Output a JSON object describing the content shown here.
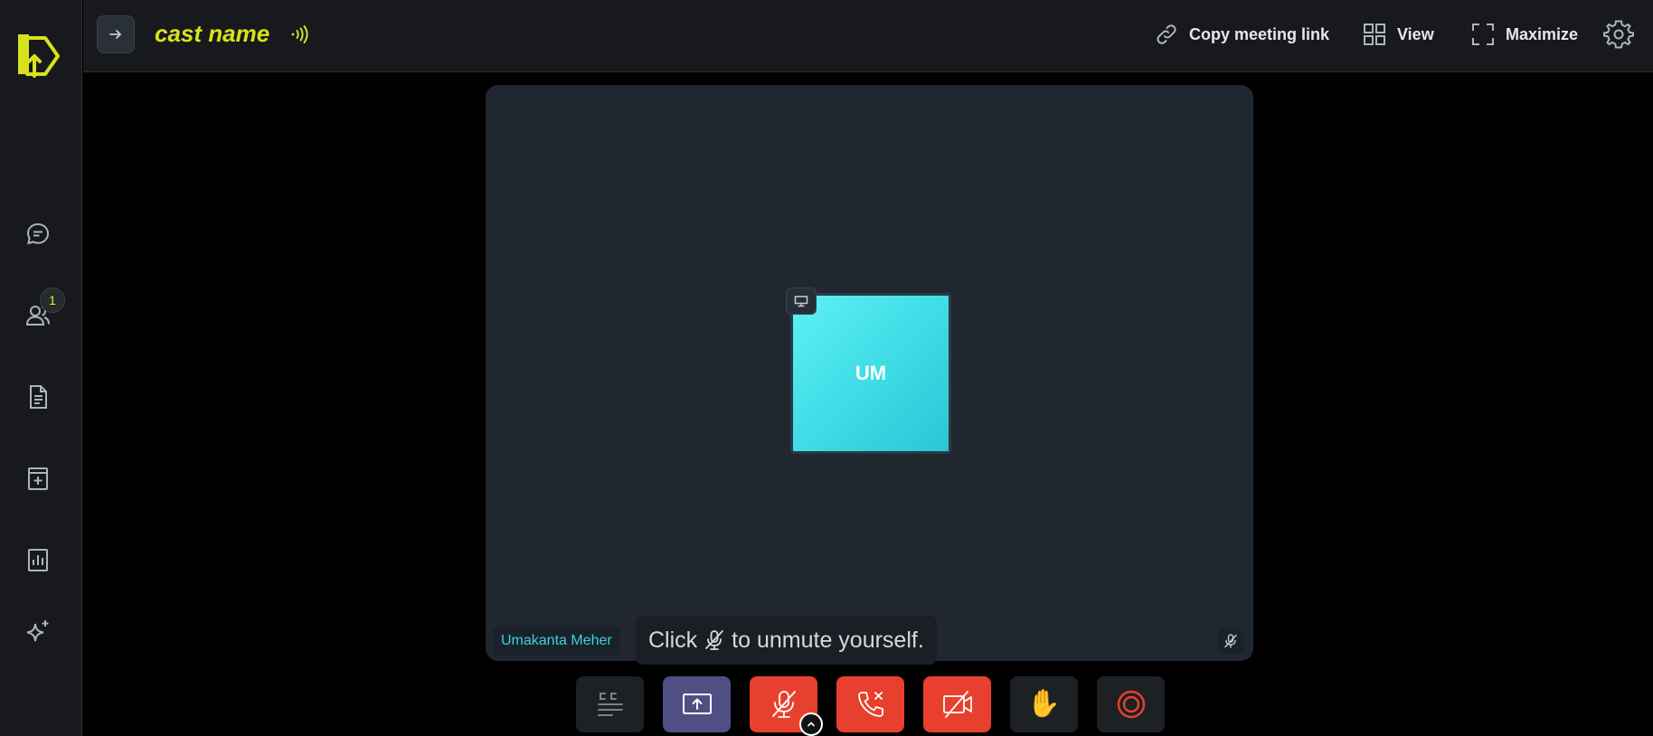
{
  "app": {
    "brand_color": "#d8e21a",
    "accent_color": "#3fd0df",
    "danger_color": "#e8402f"
  },
  "sidebar": {
    "items": [
      {
        "name": "chat",
        "icon": "chat-bubble-icon"
      },
      {
        "name": "participants",
        "icon": "users-icon",
        "badge": "1"
      },
      {
        "name": "notes",
        "icon": "document-icon"
      },
      {
        "name": "whiteboard",
        "icon": "add-page-icon"
      },
      {
        "name": "polls",
        "icon": "bar-chart-icon"
      },
      {
        "name": "ai",
        "icon": "sparkle-icon"
      }
    ]
  },
  "header": {
    "title": "cast name",
    "actions": {
      "copy_link": "Copy meeting link",
      "view": "View",
      "maximize": "Maximize"
    }
  },
  "stage": {
    "participant": {
      "initials": "UM",
      "name": "Umakanta Meher"
    },
    "tip": {
      "before": "Click",
      "after": "to unmute yourself."
    }
  },
  "controls": [
    {
      "name": "captions",
      "icon": "closed-captions-icon"
    },
    {
      "name": "share-screen",
      "icon": "screen-share-icon"
    },
    {
      "name": "microphone",
      "icon": "mic-off-icon"
    },
    {
      "name": "leave-call",
      "icon": "phone-hangup-icon"
    },
    {
      "name": "camera",
      "icon": "camera-off-icon"
    },
    {
      "name": "raise-hand",
      "icon": "raised-hand-icon",
      "glyph": "✋"
    },
    {
      "name": "record",
      "icon": "record-icon"
    }
  ]
}
